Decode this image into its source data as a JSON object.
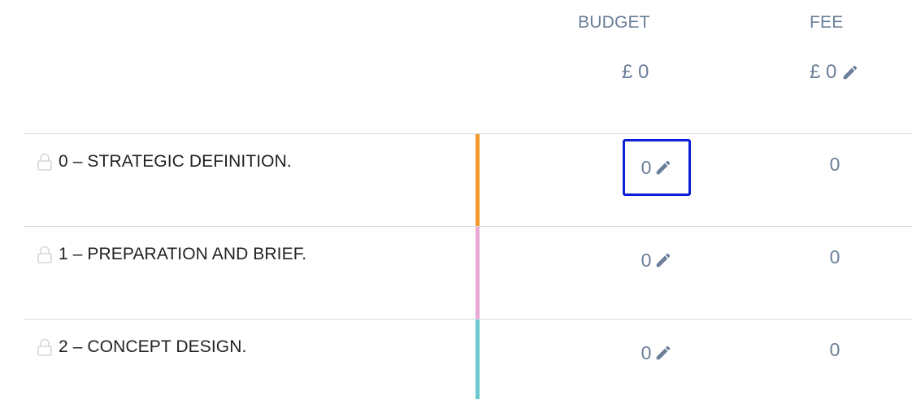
{
  "header": {
    "budget_label": "BUDGET",
    "fee_label": "FEE"
  },
  "totals": {
    "budget": "£ 0",
    "fee": "£ 0"
  },
  "stages": [
    {
      "label": "0 – STRATEGIC DEFINITION.",
      "budget": "0",
      "fee": "0",
      "color": "#f39a2e",
      "icon": "lock-icon"
    },
    {
      "label": "1 – PREPARATION AND BRIEF.",
      "budget": "0",
      "fee": "0",
      "color": "#e8a8d3",
      "icon": "lock-icon"
    },
    {
      "label": "2 – CONCEPT DESIGN.",
      "budget": "0",
      "fee": "0",
      "color": "#6cc9cf",
      "icon": "lock-icon"
    }
  ],
  "colors": {
    "text_muted": "#6b7f99",
    "focus_border": "#0a1fd6",
    "divider": "#d9d9d9"
  }
}
